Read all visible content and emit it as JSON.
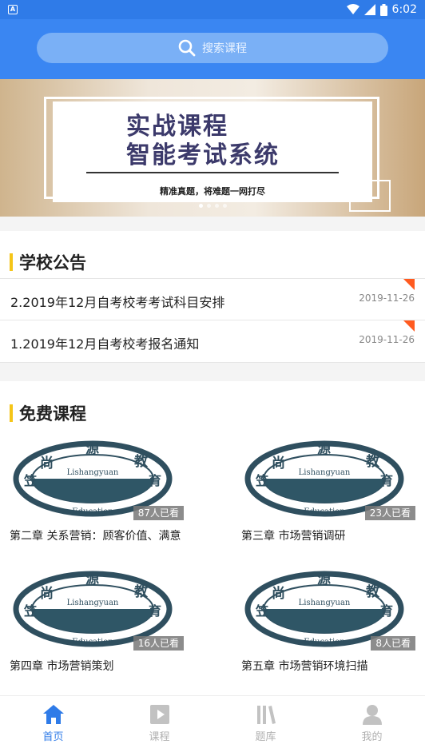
{
  "status_bar": {
    "app_icon": "A",
    "time": "6:02",
    "icons": [
      "wifi-icon",
      "signal-icon",
      "battery-icon"
    ]
  },
  "search": {
    "placeholder": "搜索课程",
    "icon": "search-icon"
  },
  "banner": {
    "title_line1": "实战课程",
    "title_line2": "智能考试系统",
    "subtitle": "精准真题，将难题一网打尽",
    "slides": 4,
    "active_slide": 1
  },
  "notices": {
    "title": "学校公告",
    "items": [
      {
        "title": "2.2019年12月自考校考考试科目安排",
        "date": "2019-11-26"
      },
      {
        "title": "1.2019年12月自考校考报名通知",
        "date": "2019-11-26"
      }
    ]
  },
  "courses": {
    "title": "免费课程",
    "logo_text": {
      "chars": [
        "尚",
        "源",
        "教",
        "育",
        "笠"
      ],
      "band": "Lishangyuan",
      "bottom": "Education"
    },
    "items": [
      {
        "title": "第二章 关系营销：顾客价值、满意",
        "views": "87人已看"
      },
      {
        "title": "第三章 市场营销调研",
        "views": "23人已看"
      },
      {
        "title": "第四章 市场营销策划",
        "views": "16人已看"
      },
      {
        "title": "第五章 市场营销环境扫描",
        "views": "8人已看"
      }
    ]
  },
  "tabbar": {
    "items": [
      {
        "label": "首页",
        "icon": "home-icon",
        "active": true
      },
      {
        "label": "课程",
        "icon": "play-icon",
        "active": false
      },
      {
        "label": "题库",
        "icon": "books-icon",
        "active": false
      },
      {
        "label": "我的",
        "icon": "user-icon",
        "active": false
      }
    ]
  },
  "colors": {
    "primary": "#2f7be8",
    "accent_bar": "#f5c518",
    "notice_flag": "#ff5a1f"
  }
}
